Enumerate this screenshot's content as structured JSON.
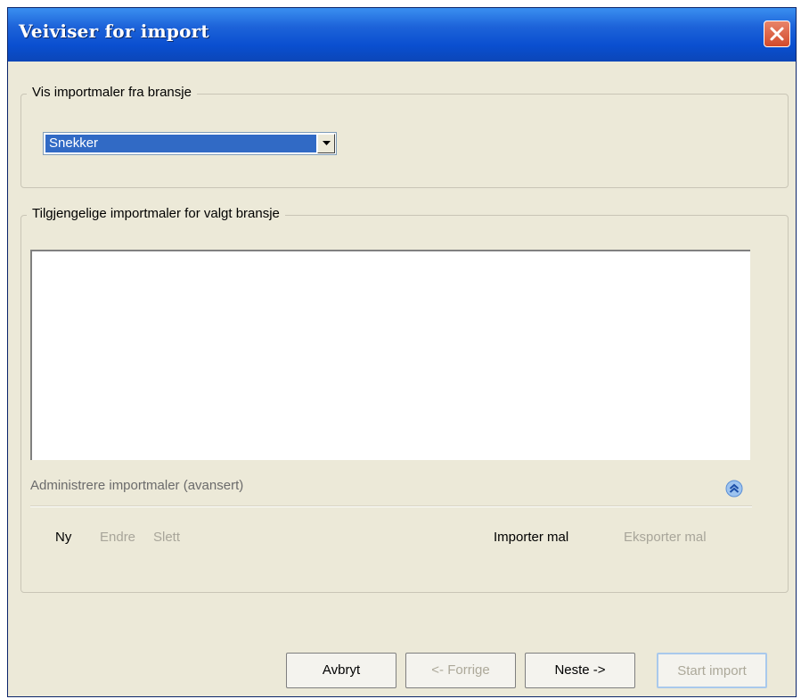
{
  "window": {
    "title": "Veiviser for import"
  },
  "industry_group": {
    "legend": "Vis importmaler fra bransje",
    "selected_value": "Snekker"
  },
  "templates_group": {
    "legend": "Tilgjengelige importmaler for valgt bransje",
    "items": []
  },
  "admin": {
    "label": "Administrere importmaler (avansert)",
    "actions": {
      "new": "Ny",
      "edit": "Endre",
      "delete": "Slett",
      "import": "Importer mal",
      "export": "Eksporter mal"
    }
  },
  "footer": {
    "cancel": "Avbryt",
    "previous": "<- Forrige",
    "next": "Neste ->",
    "start": "Start import"
  },
  "colors": {
    "titlebar": "#0a4fd0",
    "selection": "#316ac5",
    "disabled_text": "#a8a59a",
    "face": "#ece9d8"
  },
  "icons": {
    "close": "close-icon",
    "dropdown": "chevron-down-icon",
    "collapse": "double-chevron-up-icon"
  }
}
